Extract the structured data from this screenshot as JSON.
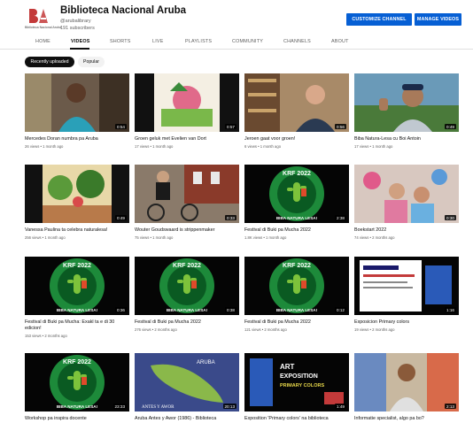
{
  "channel": {
    "logo_caption": "Biblioteca Nacional Aruba",
    "name": "Biblioteca Nacional Aruba",
    "handle": "@arubalibrary",
    "subscribers": "191 subscribers",
    "brand_color": "#c33a3a"
  },
  "actions": {
    "customize": "CUSTOMIZE CHANNEL",
    "manage": "MANAGE VIDEOS",
    "button_color": "#065fd4"
  },
  "tabs": [
    {
      "label": "HOME",
      "active": false
    },
    {
      "label": "VIDEOS",
      "active": true
    },
    {
      "label": "SHORTS",
      "active": false
    },
    {
      "label": "LIVE",
      "active": false
    },
    {
      "label": "PLAYLISTS",
      "active": false
    },
    {
      "label": "COMMUNITY",
      "active": false
    },
    {
      "label": "CHANNELS",
      "active": false
    },
    {
      "label": "ABOUT",
      "active": false
    }
  ],
  "filters": {
    "recent": "Recently uploaded",
    "popular": "Popular",
    "selected": "Recently uploaded"
  },
  "videos": [
    {
      "title": "Mercedes Doran numbra pa Aruba",
      "views": "26 views",
      "age": "1 month ago",
      "duration": "0:54",
      "thumb": "portrait-woman"
    },
    {
      "title": "Groen geluk met Evelien van Dort",
      "views": "17 views",
      "age": "1 month ago",
      "duration": "0:57",
      "thumb": "illustration-plant"
    },
    {
      "title": "Jeroen gaat voor groen!",
      "views": "6 views",
      "age": "1 month ago",
      "duration": "0:56",
      "thumb": "man-bookshelf"
    },
    {
      "title": "Biba Natura-Lesa cu Boi Antoin",
      "views": "17 views",
      "age": "1 month ago",
      "duration": "0:49",
      "thumb": "man-outdoors"
    },
    {
      "title": "Vanessa Paulina ta celebra naturalesa!",
      "views": "256 views",
      "age": "1 month ago",
      "duration": "0:49",
      "thumb": "illustration-garden"
    },
    {
      "title": "Wouter Goudswaard is strippenmaker",
      "views": "75 views",
      "age": "1 month ago",
      "duration": "0:33",
      "thumb": "man-bicycle"
    },
    {
      "title": "Festival di Buki pa Mucha 2022",
      "views": "1.8K views",
      "age": "1 month ago",
      "duration": "2:38",
      "thumb": "krf-logo"
    },
    {
      "title": "Boekstart 2022",
      "views": "74 views",
      "age": "2 months ago",
      "duration": "0:30",
      "thumb": "kids-balloons"
    },
    {
      "title": "Festival di Buki pa Mucha: Exakl ta e di 30 edicion!",
      "views": "153 views",
      "age": "2 months ago",
      "duration": "0:36",
      "thumb": "krf-logo"
    },
    {
      "title": "Festival di Buki pa Mucha 2022",
      "views": "276 views",
      "age": "2 months ago",
      "duration": "0:38",
      "thumb": "krf-logo"
    },
    {
      "title": "Festival di Buki pa Mucha 2022",
      "views": "121 views",
      "age": "2 months ago",
      "duration": "0:12",
      "thumb": "krf-logo"
    },
    {
      "title": "Exposicion Primary colors",
      "views": "19 views",
      "age": "2 months ago",
      "duration": "1:16",
      "thumb": "expo-poster"
    },
    {
      "title": "Workshop pa inspira docente",
      "views": "",
      "age": "",
      "duration": "23:33",
      "thumb": "krf-logo"
    },
    {
      "title": "Aruba Antes y Awor (1986) - Biblioteca",
      "views": "",
      "age": "",
      "duration": "20:13",
      "thumb": "aruba-map"
    },
    {
      "title": "Exposition 'Primary colors' na biblioteca",
      "views": "",
      "age": "",
      "duration": "1:49",
      "thumb": "expo-art"
    },
    {
      "title": "Informatie specialist, algo pa bo?",
      "views": "",
      "age": "",
      "duration": "2:13",
      "thumb": "woman-library"
    }
  ],
  "thumb_text": {
    "krf_top": "KRF 2022",
    "krf_bottom": "BIBA NATURA LESA!",
    "expo_line1": "ART",
    "expo_line2": "EXPOSITION",
    "expo_line3": "PRIMARY COLORS",
    "map_label": "ARUBA",
    "map_caption": "ANTES Y AWOR"
  }
}
